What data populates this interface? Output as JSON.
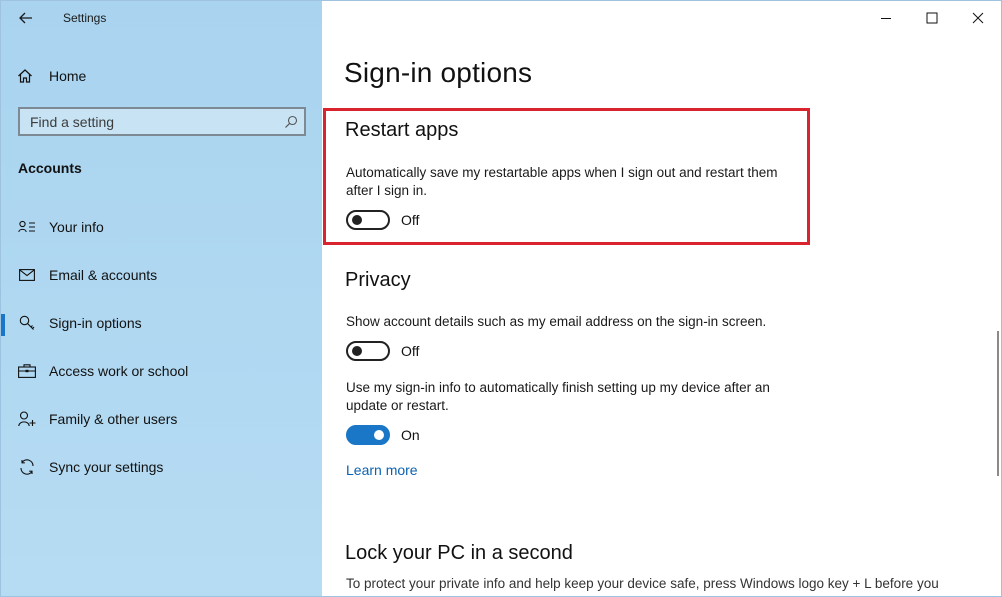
{
  "window": {
    "title": "Settings",
    "controls": {
      "minimize": "minimize-icon",
      "maximize": "maximize-icon",
      "close": "close-icon"
    }
  },
  "sidebar": {
    "home_label": "Home",
    "search_placeholder": "Find a setting",
    "section_header": "Accounts",
    "items": [
      {
        "label": "Your info",
        "icon": "person-card-icon"
      },
      {
        "label": "Email & accounts",
        "icon": "mail-icon"
      },
      {
        "label": "Sign-in options",
        "icon": "key-icon",
        "active": true
      },
      {
        "label": "Access work or school",
        "icon": "briefcase-icon"
      },
      {
        "label": "Family & other users",
        "icon": "person-add-icon"
      },
      {
        "label": "Sync your settings",
        "icon": "sync-icon"
      }
    ]
  },
  "main": {
    "page_title": "Sign-in options",
    "restart_apps": {
      "heading": "Restart apps",
      "description": "Automatically save my restartable apps when I sign out and restart them after I sign in.",
      "toggle_state": "Off"
    },
    "privacy": {
      "heading": "Privacy",
      "setting1": {
        "description": "Show account details such as my email address on the sign-in screen.",
        "toggle_state": "Off"
      },
      "setting2": {
        "description": "Use my sign-in info to automatically finish setting up my device after an update or restart.",
        "toggle_state": "On"
      },
      "learn_more": "Learn more"
    },
    "lock": {
      "heading": "Lock your PC in a second",
      "description": "To protect your private info and help keep your device safe, press Windows logo key + L before you"
    }
  },
  "colors": {
    "accent": "#1a76c6",
    "highlight_border": "#d9232e",
    "sidebar_bg": "#b0d8f1",
    "link": "#0b62b0"
  }
}
